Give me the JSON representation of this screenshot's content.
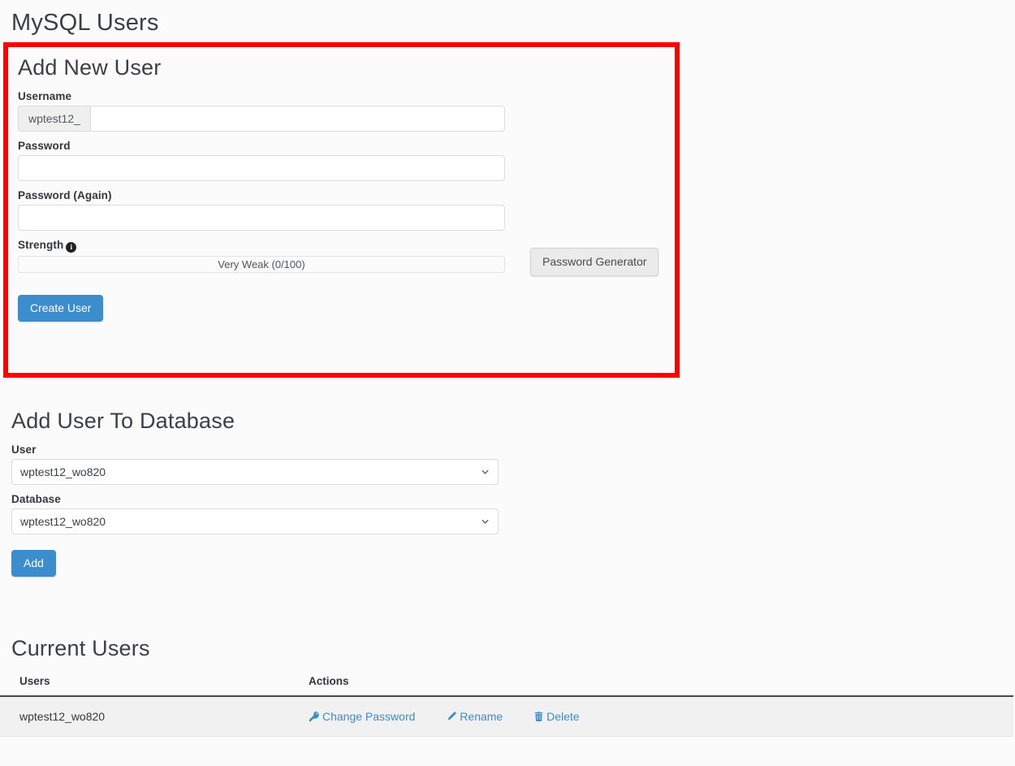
{
  "page": {
    "title": "MySQL Users"
  },
  "add_new_user": {
    "heading": "Add New User",
    "username_label": "Username",
    "username_prefix": "wptest12_",
    "username_value": "",
    "username_placeholder": "",
    "password_label": "Password",
    "password_value": "",
    "password_placeholder": "",
    "password_again_label": "Password (Again)",
    "password_again_value": "",
    "password_again_placeholder": "",
    "strength_label": "Strength",
    "strength_info_icon": "info-icon",
    "strength_text": "Very Weak (0/100)",
    "strength_value": 0,
    "strength_max": 100,
    "password_generator_label": "Password Generator",
    "create_user_label": "Create User",
    "highlight_color": "#fe0000"
  },
  "add_user_to_database": {
    "heading": "Add User To Database",
    "user_label": "User",
    "user_selected": "wptest12_wo820",
    "database_label": "Database",
    "database_selected": "wptest12_wo820",
    "add_label": "Add"
  },
  "current_users": {
    "heading": "Current Users",
    "columns": [
      "Users",
      "Actions"
    ],
    "rows": [
      {
        "user": "wptest12_wo820",
        "actions": [
          {
            "label": "Change Password",
            "icon": "key-icon"
          },
          {
            "label": "Rename",
            "icon": "pencil-icon"
          },
          {
            "label": "Delete",
            "icon": "trash-icon"
          }
        ]
      }
    ],
    "link_color": "#3c8dcd"
  }
}
